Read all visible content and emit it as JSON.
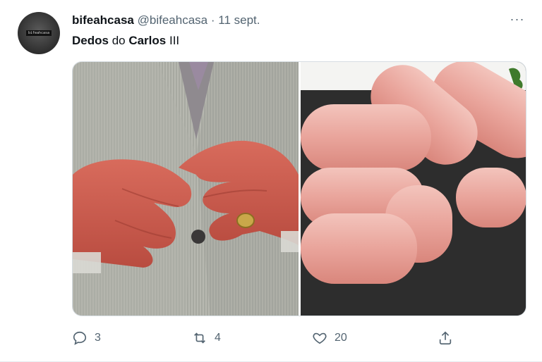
{
  "tweet": {
    "author": {
      "name": "bifeahcasa",
      "handle": "@bifeahcasa",
      "avatar_text": "bifeahcasa"
    },
    "separator": "·",
    "date": "11 sept.",
    "text": {
      "part1": "Dedos",
      "part2": " do ",
      "part3": "Carlos",
      "part4": " III"
    },
    "more_label": "···",
    "actions": {
      "replies": "3",
      "retweets": "4",
      "likes": "20"
    },
    "icons": [
      "reply-icon",
      "retweet-icon",
      "like-icon",
      "share-icon",
      "more-icon"
    ]
  }
}
